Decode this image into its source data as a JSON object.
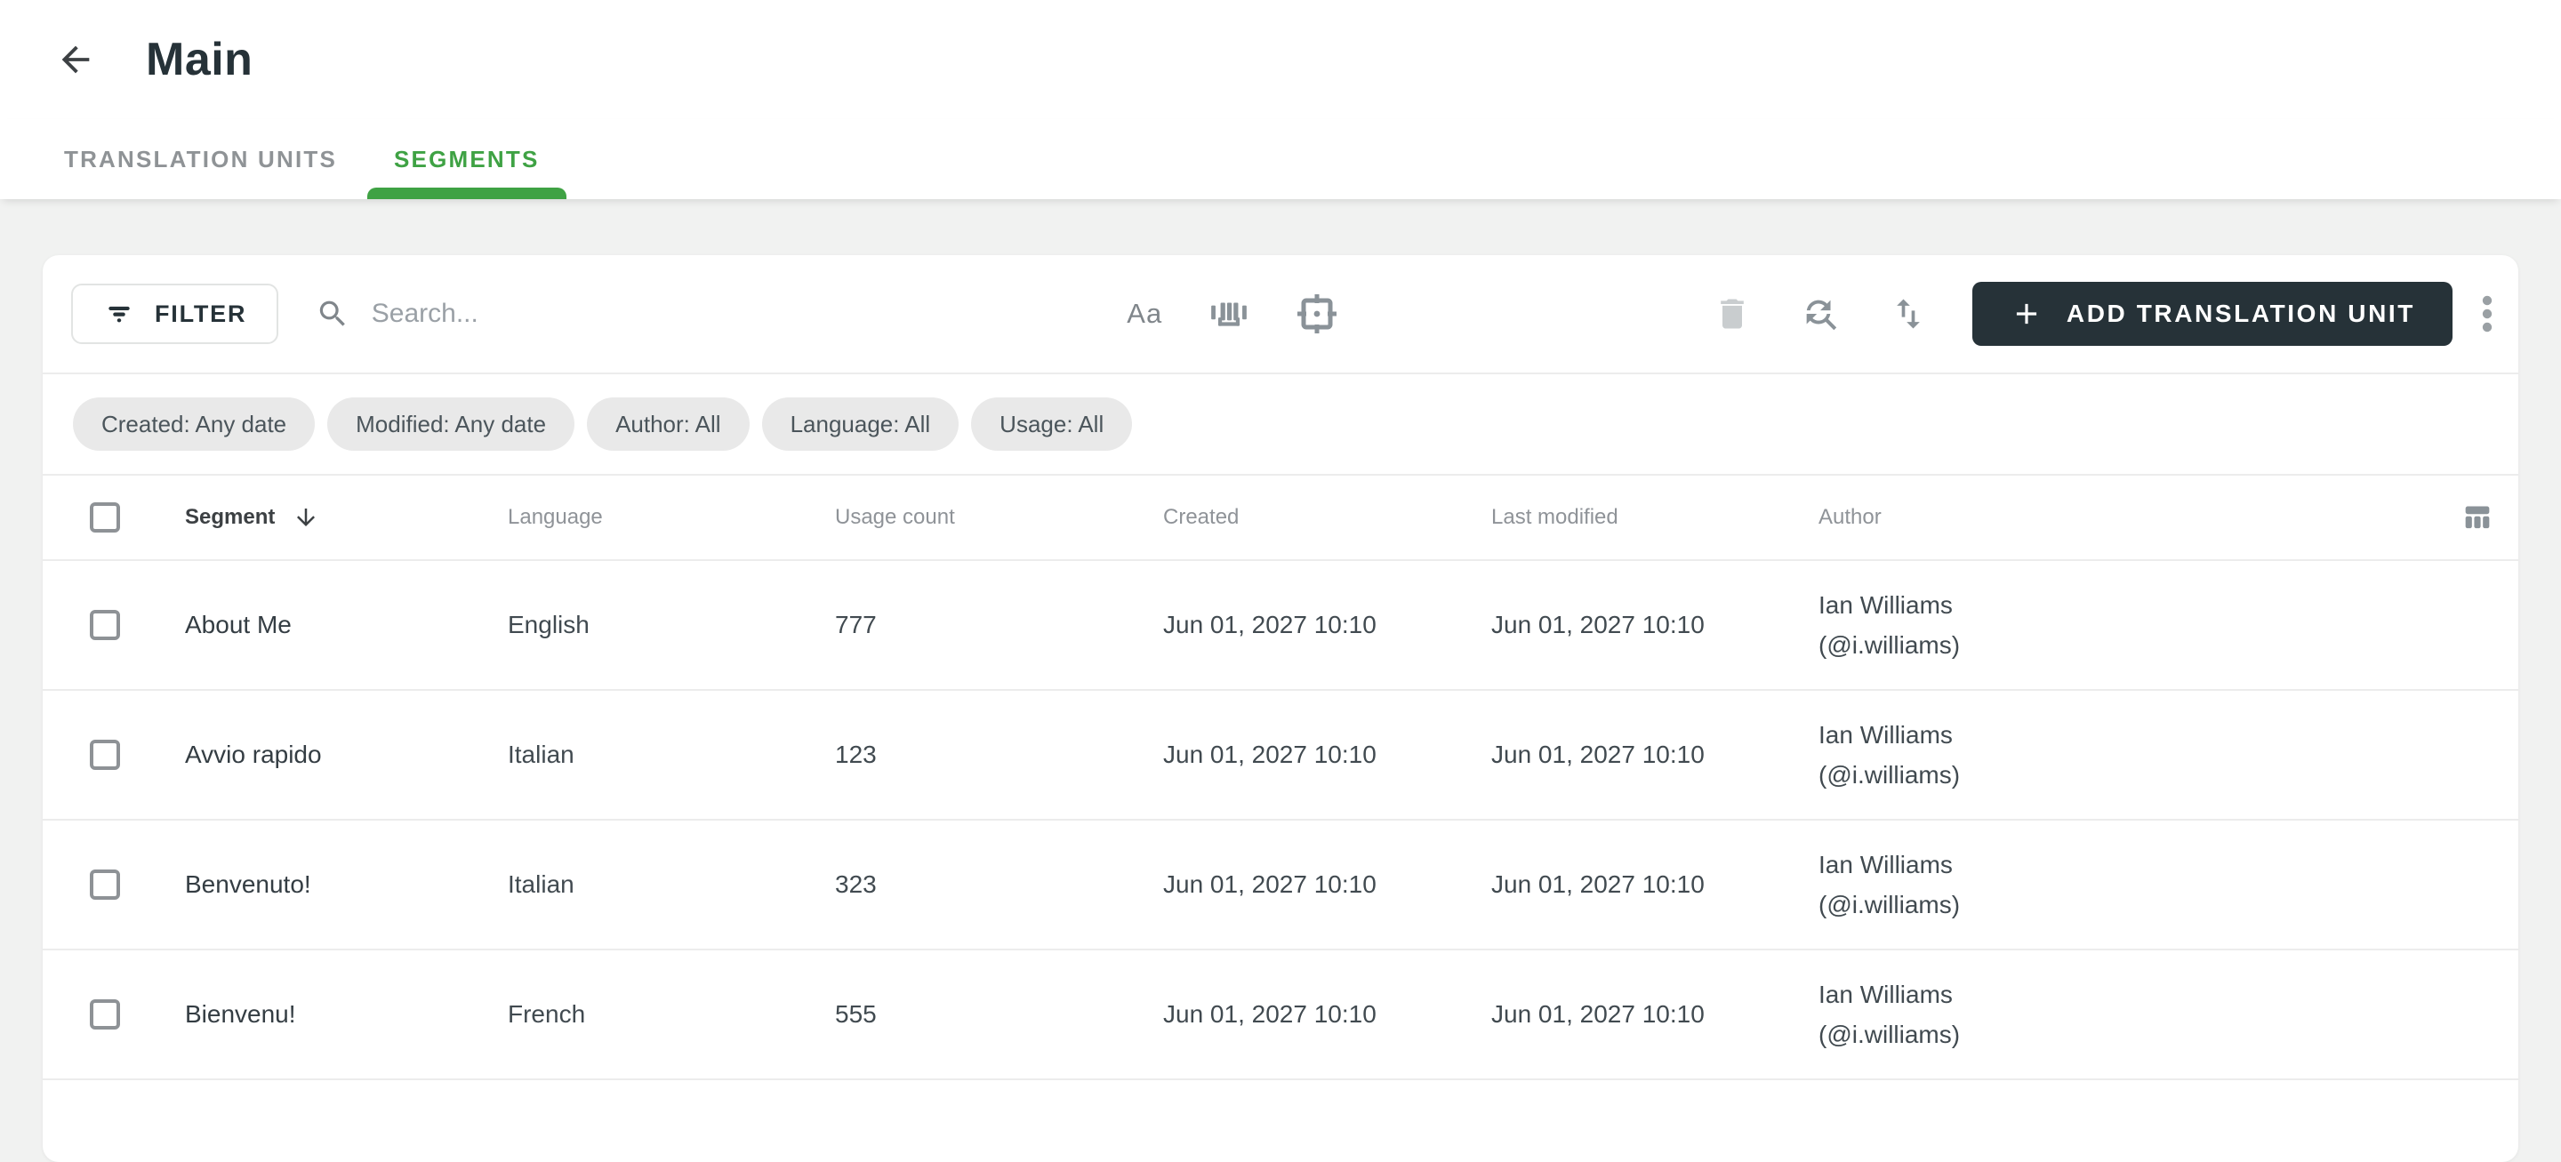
{
  "header": {
    "title": "Main"
  },
  "tabs": [
    {
      "label": "TRANSLATION UNITS",
      "active": false
    },
    {
      "label": "SEGMENTS",
      "active": true
    }
  ],
  "toolbar": {
    "filter_label": "FILTER",
    "search_placeholder": "Search...",
    "search_value": "",
    "match_case_glyph": "Aa",
    "add_button_label": "ADD TRANSLATION UNIT"
  },
  "icons": {
    "back": "arrow-left-icon",
    "filter": "funnel-lines-icon",
    "search": "magnifier-icon",
    "match_case": "Aa-letters-icon",
    "whole_word": "barcode-underline-icon",
    "center_focus": "frame-center-dot-icon",
    "delete": "trash-icon",
    "find_replace": "circular-arrows-magnifier-icon",
    "sort": "up-down-arrows-icon",
    "add": "plus-icon",
    "more": "kebab-vertical-dots-icon",
    "column_picker": "table-columns-icon",
    "sort_direction": "arrow-down-icon"
  },
  "filters": {
    "chips": [
      "Created: Any date",
      "Modified: Any date",
      "Author: All",
      "Language: All",
      "Usage: All"
    ]
  },
  "table": {
    "columns": [
      "Segment",
      "Language",
      "Usage count",
      "Created",
      "Last modified",
      "Author"
    ],
    "sort": {
      "column": "Segment",
      "direction": "desc"
    },
    "rows": [
      {
        "segment": "About Me",
        "language": "English",
        "usage_count": "777",
        "created": "Jun 01, 2027 10:10",
        "last_modified": "Jun 01, 2027 10:10",
        "author_name": "Ian Williams",
        "author_handle": "(@i.williams)",
        "checked": false
      },
      {
        "segment": "Avvio rapido",
        "language": "Italian",
        "usage_count": "123",
        "created": "Jun 01, 2027 10:10",
        "last_modified": "Jun 01, 2027 10:10",
        "author_name": "Ian Williams",
        "author_handle": "(@i.williams)",
        "checked": false
      },
      {
        "segment": "Benvenuto!",
        "language": "Italian",
        "usage_count": "323",
        "created": "Jun 01, 2027 10:10",
        "last_modified": "Jun 01, 2027 10:10",
        "author_name": "Ian Williams",
        "author_handle": "(@i.williams)",
        "checked": false
      },
      {
        "segment": "Bienvenu!",
        "language": "French",
        "usage_count": "555",
        "created": "Jun 01, 2027 10:10",
        "last_modified": "Jun 01, 2027 10:10",
        "author_name": "Ian Williams",
        "author_handle": "(@i.williams)",
        "checked": false
      }
    ]
  },
  "colors": {
    "accent_green": "#3FA244",
    "button_dark": "#263238",
    "chip_bg": "#E9E9E9",
    "page_bg": "#F1F2F1",
    "divider": "#ECECEC",
    "muted_icon": "#8A9298",
    "disabled_icon": "#C9CDCF"
  }
}
